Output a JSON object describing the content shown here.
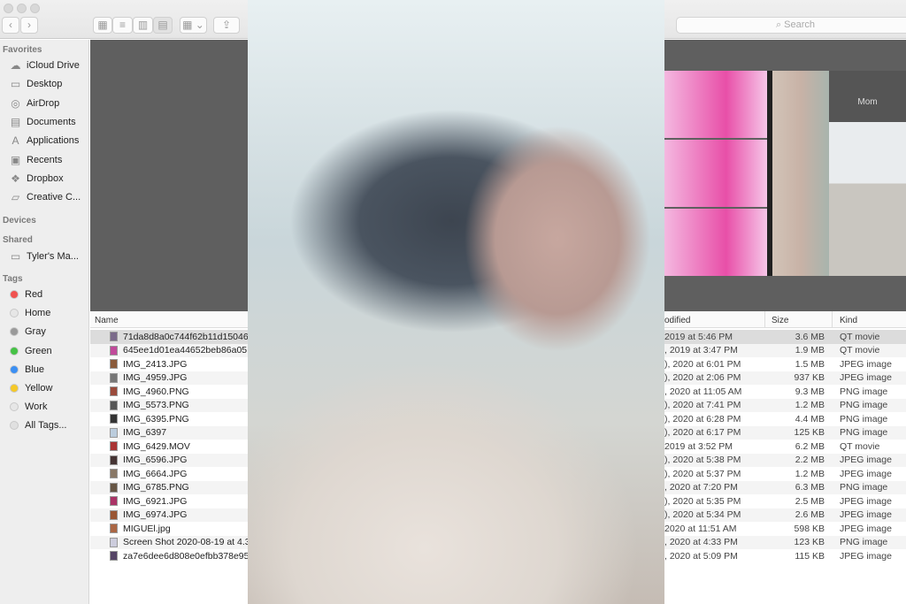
{
  "toolbar": {
    "back": "‹",
    "forward": "›",
    "view_icons": "▦",
    "view_list": "≡",
    "view_columns": "▥",
    "view_gallery": "▤",
    "group": "▦ ⌄",
    "share": "⇪",
    "search_placeholder": "Search",
    "search_icon": "magnifier-icon"
  },
  "sidebar": {
    "favorites_label": "Favorites",
    "favorites": [
      {
        "label": "iCloud Drive",
        "icon": "☁"
      },
      {
        "label": "Desktop",
        "icon": "▭"
      },
      {
        "label": "AirDrop",
        "icon": "◎"
      },
      {
        "label": "Documents",
        "icon": "▤"
      },
      {
        "label": "Applications",
        "icon": "A"
      },
      {
        "label": "Recents",
        "icon": "▣"
      },
      {
        "label": "Dropbox",
        "icon": "❖"
      },
      {
        "label": "Creative C...",
        "icon": "▱"
      }
    ],
    "devices_label": "Devices",
    "shared_label": "Shared",
    "shared": [
      {
        "label": "Tyler's Ma...",
        "icon": "▭"
      }
    ],
    "tags_label": "Tags",
    "tags": [
      {
        "label": "Red",
        "color": "#f0524f"
      },
      {
        "label": "Home",
        "color": "#e6e6e6"
      },
      {
        "label": "Gray",
        "color": "#9a9a9a"
      },
      {
        "label": "Green",
        "color": "#45c245"
      },
      {
        "label": "Blue",
        "color": "#3b8ff3"
      },
      {
        "label": "Yellow",
        "color": "#f5c928"
      },
      {
        "label": "Work",
        "color": "#e6e6e6"
      },
      {
        "label": "All Tags...",
        "color": "#e0e0e0"
      }
    ]
  },
  "gallery": {
    "preview_caption": "Mom"
  },
  "columns": {
    "name": "Name",
    "modified": "odified",
    "size": "Size",
    "kind": "Kind"
  },
  "files": [
    {
      "name": "71da8d8a0c744f62b11d15046",
      "modified": " 2019 at 5:46 PM",
      "size": "3.6 MB",
      "kind": "QT movie"
    },
    {
      "name": "645ee1d01ea44652beb86a05",
      "modified": ", 2019 at 3:47 PM",
      "size": "1.9 MB",
      "kind": "QT movie"
    },
    {
      "name": "IMG_2413.JPG",
      "modified": "), 2020 at 6:01 PM",
      "size": "1.5 MB",
      "kind": "JPEG image"
    },
    {
      "name": "IMG_4959.JPG",
      "modified": "), 2020 at 2:06 PM",
      "size": "937 KB",
      "kind": "JPEG image"
    },
    {
      "name": "IMG_4960.PNG",
      "modified": ", 2020 at 11:05 AM",
      "size": "9.3 MB",
      "kind": "PNG image"
    },
    {
      "name": "IMG_5573.PNG",
      "modified": "), 2020 at 7:41 PM",
      "size": "1.2 MB",
      "kind": "PNG image"
    },
    {
      "name": "IMG_6395.PNG",
      "modified": "), 2020 at 6:28 PM",
      "size": "4.4 MB",
      "kind": "PNG image"
    },
    {
      "name": "IMG_6397",
      "modified": "), 2020 at 6:17 PM",
      "size": "125 KB",
      "kind": "PNG image"
    },
    {
      "name": "IMG_6429.MOV",
      "modified": " 2019 at 3:52 PM",
      "size": "6.2 MB",
      "kind": "QT movie"
    },
    {
      "name": "IMG_6596.JPG",
      "modified": "), 2020 at 5:38 PM",
      "size": "2.2 MB",
      "kind": "JPEG image"
    },
    {
      "name": "IMG_6664.JPG",
      "modified": "), 2020 at 5:37 PM",
      "size": "1.2 MB",
      "kind": "JPEG image"
    },
    {
      "name": "IMG_6785.PNG",
      "modified": ", 2020 at 7:20 PM",
      "size": "6.3 MB",
      "kind": "PNG image"
    },
    {
      "name": "IMG_6921.JPG",
      "modified": "), 2020 at 5:35 PM",
      "size": "2.5 MB",
      "kind": "JPEG image"
    },
    {
      "name": "IMG_6974.JPG",
      "modified": "), 2020 at 5:34 PM",
      "size": "2.6 MB",
      "kind": "JPEG image"
    },
    {
      "name": "MIGUEl.jpg",
      "modified": " 2020 at 11:51 AM",
      "size": "598 KB",
      "kind": "JPEG image"
    },
    {
      "name": "Screen Shot 2020-08-19 at 4.3",
      "modified": ", 2020 at 4:33 PM",
      "size": "123 KB",
      "kind": "PNG image"
    },
    {
      "name": "za7e6dee6d808e0efbb378e95",
      "modified": ", 2020 at 5:09 PM",
      "size": "115 KB",
      "kind": "JPEG image"
    }
  ]
}
